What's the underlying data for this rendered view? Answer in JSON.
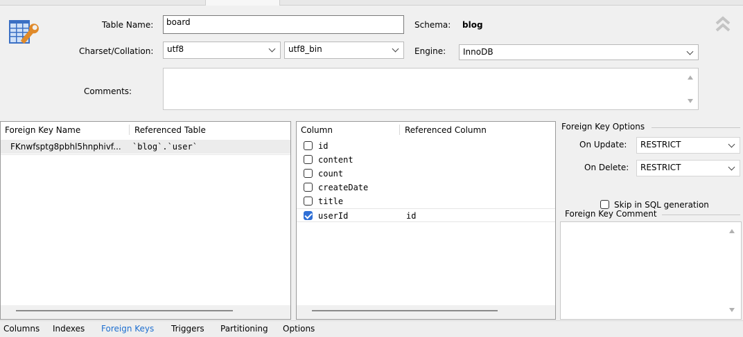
{
  "table_form": {
    "table_name_label": "Table Name:",
    "table_name_value": "board",
    "schema_label": "Schema:",
    "schema_value": "blog",
    "charset_label": "Charset/Collation:",
    "charset_value": "utf8",
    "collation_value": "utf8_bin",
    "engine_label": "Engine:",
    "engine_value": "InnoDB",
    "comments_label": "Comments:",
    "comments_value": ""
  },
  "fk_list": {
    "headers": [
      "Foreign Key Name",
      "Referenced Table"
    ],
    "rows": [
      {
        "name": "FKnwfsptg8pbhl5hnphivf...",
        "table": "`blog`.`user`"
      }
    ]
  },
  "fk_columns": {
    "headers": [
      "Column",
      "Referenced Column"
    ],
    "rows": [
      {
        "column": "id",
        "checked": false,
        "ref": ""
      },
      {
        "column": "content",
        "checked": false,
        "ref": ""
      },
      {
        "column": "count",
        "checked": false,
        "ref": ""
      },
      {
        "column": "createDate",
        "checked": false,
        "ref": ""
      },
      {
        "column": "title",
        "checked": false,
        "ref": ""
      },
      {
        "column": "userId",
        "checked": true,
        "ref": "id"
      }
    ]
  },
  "fk_options": {
    "group_label": "Foreign Key Options",
    "on_update_label": "On Update:",
    "on_update_value": "RESTRICT",
    "on_delete_label": "On Delete:",
    "on_delete_value": "RESTRICT",
    "skip_label": "Skip in SQL generation",
    "skip_checked": false,
    "comment_label": "Foreign Key Comment",
    "comment_value": ""
  },
  "bottom_tabs": [
    {
      "label": "Columns",
      "active": false
    },
    {
      "label": "Indexes",
      "active": false
    },
    {
      "label": "Foreign Keys",
      "active": true
    },
    {
      "label": "Triggers",
      "active": false
    },
    {
      "label": "Partitioning",
      "active": false
    },
    {
      "label": "Options",
      "active": false
    }
  ],
  "colors": {
    "accent": "#2f6fd6",
    "active_tab_text": "#1e6fd0"
  }
}
